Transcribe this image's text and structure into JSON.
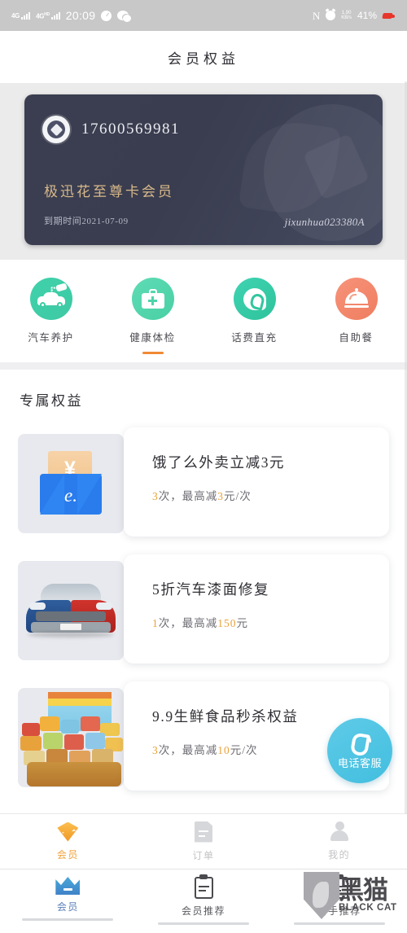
{
  "statusbar": {
    "net_label_1": "4G",
    "net_label_2": "4G",
    "net_label_2_sup": "HD",
    "time": "20:09",
    "compass_icon": "compass-icon",
    "wechat_icon": "wechat-icon",
    "nfc": "N",
    "alarm_icon": "alarm-clock-icon",
    "speed_top": "1.90",
    "speed_bottom": "KB/s",
    "battery": "41%",
    "charging_icon": "battery-charging-icon"
  },
  "header": {
    "title": "会员权益"
  },
  "card": {
    "phone": "17600569981",
    "level_name": "极迅花至尊卡会员",
    "expire": "到期时间2021-07-09",
    "serial": "jixunhua023380A",
    "avatar_icon": "diamond-avatar-icon",
    "gold_color": "#d9b98a",
    "bg_color": "#3b3e50"
  },
  "categories": [
    {
      "label": "汽车养护",
      "icon": "car-wash-icon",
      "active": false
    },
    {
      "label": "健康体检",
      "icon": "medical-kit-icon",
      "active": true
    },
    {
      "label": "话费直充",
      "icon": "phone-bubble-icon",
      "active": false
    },
    {
      "label": "自助餐",
      "icon": "food-cloche-icon",
      "active": false
    }
  ],
  "category_indicator_color": "#f08a35",
  "benefits_section": {
    "title": "专属权益",
    "items": [
      {
        "title": "饿了么外卖立减3元",
        "sub_count": "3",
        "sub_mid": "次，最高减",
        "sub_amount": "3",
        "sub_tail": "元/次",
        "thumb_icon": "eleme-envelope-icon"
      },
      {
        "title": "5折汽车漆面修复",
        "sub_count": "1",
        "sub_mid": "次，最高减",
        "sub_amount": "150",
        "sub_tail": "元",
        "thumb_icon": "car-paint-repair-icon"
      },
      {
        "title": "9.9生鲜食品秒杀权益",
        "sub_count": "3",
        "sub_mid": "次，最高减",
        "sub_amount": "10",
        "sub_tail": "元/次",
        "thumb_icon": "snack-assortment-icon"
      }
    ],
    "highlight_color": "#e9a23b"
  },
  "customer_service": {
    "label": "电话客服",
    "icon": "phone-call-icon",
    "color": "#4fc3e0"
  },
  "tabbar": {
    "items": [
      {
        "label": "会员",
        "icon": "diamond-icon",
        "active": true
      },
      {
        "label": "订单",
        "icon": "document-icon",
        "active": false
      },
      {
        "label": "我的",
        "icon": "person-icon",
        "active": false
      }
    ],
    "active_color": "#f0a13a"
  },
  "sysnav": {
    "items": [
      {
        "label": "会员",
        "icon": "crown-icon",
        "active": true
      },
      {
        "label": "会员推荐",
        "icon": "clipboard-icon",
        "active": false
      },
      {
        "label": "新手推荐",
        "icon": "clipboard-icon",
        "active": false
      }
    ]
  },
  "watermark": {
    "cn": "黑猫",
    "en": "BLACK CAT",
    "icon": "black-cat-shield-icon"
  }
}
